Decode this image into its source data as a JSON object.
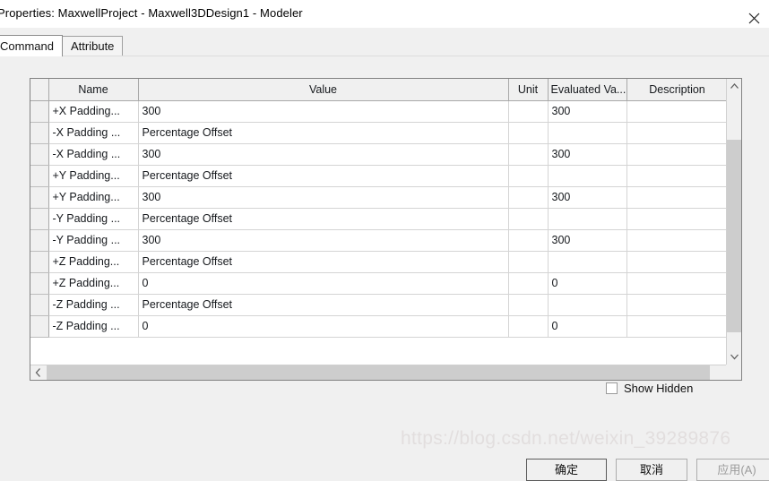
{
  "window": {
    "title": "Properties: MaxwellProject - Maxwell3DDesign1 - Modeler",
    "close_icon": "close-icon"
  },
  "tabs": [
    {
      "label": "Command",
      "selected": true
    },
    {
      "label": "Attribute",
      "selected": false
    }
  ],
  "grid": {
    "columns": [
      "Name",
      "Value",
      "Unit",
      "Evaluated Va...",
      "Description"
    ],
    "rows": [
      {
        "name": "+X Padding...",
        "value": "300",
        "unit": "",
        "evaluated": "300",
        "description": ""
      },
      {
        "name": "-X Padding ...",
        "value": "Percentage Offset",
        "unit": "",
        "evaluated": "",
        "description": ""
      },
      {
        "name": "-X Padding ...",
        "value": "300",
        "unit": "",
        "evaluated": "300",
        "description": ""
      },
      {
        "name": "+Y Padding...",
        "value": "Percentage Offset",
        "unit": "",
        "evaluated": "",
        "description": ""
      },
      {
        "name": "+Y Padding...",
        "value": "300",
        "unit": "",
        "evaluated": "300",
        "description": ""
      },
      {
        "name": "-Y Padding ...",
        "value": "Percentage Offset",
        "unit": "",
        "evaluated": "",
        "description": ""
      },
      {
        "name": "-Y Padding ...",
        "value": "300",
        "unit": "",
        "evaluated": "300",
        "description": ""
      },
      {
        "name": "+Z Padding...",
        "value": "Percentage Offset",
        "unit": "",
        "evaluated": "",
        "description": ""
      },
      {
        "name": "+Z Padding...",
        "value": "0",
        "unit": "",
        "evaluated": "0",
        "description": ""
      },
      {
        "name": "-Z Padding ...",
        "value": "Percentage Offset",
        "unit": "",
        "evaluated": "",
        "description": ""
      },
      {
        "name": "-Z Padding ...",
        "value": "0",
        "unit": "",
        "evaluated": "0",
        "description": ""
      }
    ]
  },
  "options": {
    "show_hidden_label": "Show Hidden",
    "show_hidden_checked": false
  },
  "footer": {
    "ok_label": "确定",
    "cancel_label": "取消",
    "apply_label": "应用(A)",
    "apply_disabled": true
  },
  "watermark": {
    "text": "https://blog.csdn.net/weixin_39289876"
  },
  "colors": {
    "dialog_bg": "#f0f0f0",
    "titlebar_bg": "#ffffff",
    "grid_bg": "#ffffff",
    "grid_header_bg": "#f0f0f0",
    "grid_border": "#828282",
    "scroll_thumb": "#cdcdcd",
    "text": "#16191d",
    "disabled_text": "#9b9b9b",
    "watermark": "#e2dede"
  }
}
